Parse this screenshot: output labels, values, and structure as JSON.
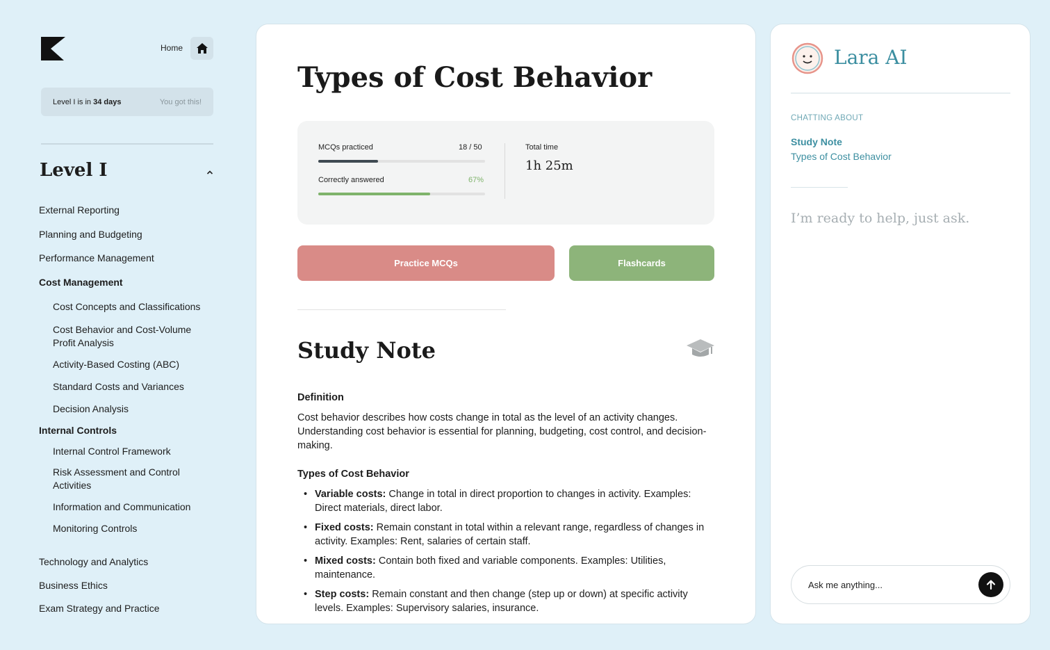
{
  "sidebar": {
    "home_label": "Home",
    "countdown": {
      "prefix": "Level I is in",
      "days": "34 days",
      "motivation": "You got this!"
    },
    "level_title": "Level I",
    "nav": [
      {
        "label": "External Reporting"
      },
      {
        "label": "Planning and Budgeting"
      },
      {
        "label": "Performance Management"
      },
      {
        "label": "Cost Management",
        "active": true
      },
      {
        "label": "Internal Controls",
        "active": true
      },
      {
        "label": "Technology and Analytics"
      },
      {
        "label": "Business Ethics"
      },
      {
        "label": "Exam Strategy and Practice"
      }
    ],
    "cost_subtopics": [
      "Cost Concepts and Classifications",
      "Cost Behavior and Cost-Volume Profit Analysis",
      "Activity-Based Costing (ABC)",
      "Standard Costs and Variances",
      "Decision Analysis"
    ],
    "control_subtopics": [
      "Internal Control Framework",
      "Risk Assessment and Control Activities",
      "Information and Communication",
      "Monitoring Controls"
    ]
  },
  "main": {
    "title": "Types of Cost Behavior",
    "stats": {
      "mcq_label": "MCQs practiced",
      "mcq_value": "18 / 50",
      "mcq_progress": 0.36,
      "correct_label": "Correctly answered",
      "correct_value": "67%",
      "correct_progress": 0.67,
      "time_label": "Total time",
      "time_value": "1h 25m"
    },
    "practice_button": "Practice MCQs",
    "flashcards_button": "Flashcards",
    "study_note_title": "Study Note",
    "definition_heading": "Definition",
    "definition_text": "Cost behavior describes how costs change in total as the level of an activity changes. Understanding cost behavior is essential for planning, budgeting, cost control, and decision-making.",
    "types_heading": "Types of Cost Behavior",
    "types": [
      {
        "term": "Variable costs:",
        "desc": "Change in total in direct proportion to changes in activity. Examples: Direct materials, direct labor."
      },
      {
        "term": "Fixed costs:",
        "desc": "Remain constant in total within a relevant range, regardless of changes in activity. Examples: Rent, salaries of certain staff."
      },
      {
        "term": "Mixed costs:",
        "desc": "Contain both fixed and variable components. Examples: Utilities, maintenance."
      },
      {
        "term": "Step costs:",
        "desc": "Remain constant and then change (step up or down) at specific activity levels. Examples: Supervisory salaries, insurance."
      }
    ]
  },
  "chat": {
    "title": "Lara AI",
    "chatting_about_label": "CHATTING ABOUT",
    "context_type": "Study Note",
    "context_title": "Types of Cost Behavior",
    "empty_message": "I’m ready to help, just ask.",
    "input_placeholder": "Ask me anything..."
  },
  "colors": {
    "background": "#dff0f8",
    "practice_button": "#d98b87",
    "flashcards_button": "#8db47a",
    "mcq_bar": "#3f4a52",
    "correct_bar": "#7fb36b",
    "accent_teal": "#3b8ea0"
  },
  "icons": [
    "logo-icon",
    "home-icon",
    "chevron-up-icon",
    "graduation-cap-icon",
    "avatar-icon",
    "arrow-up-icon"
  ]
}
